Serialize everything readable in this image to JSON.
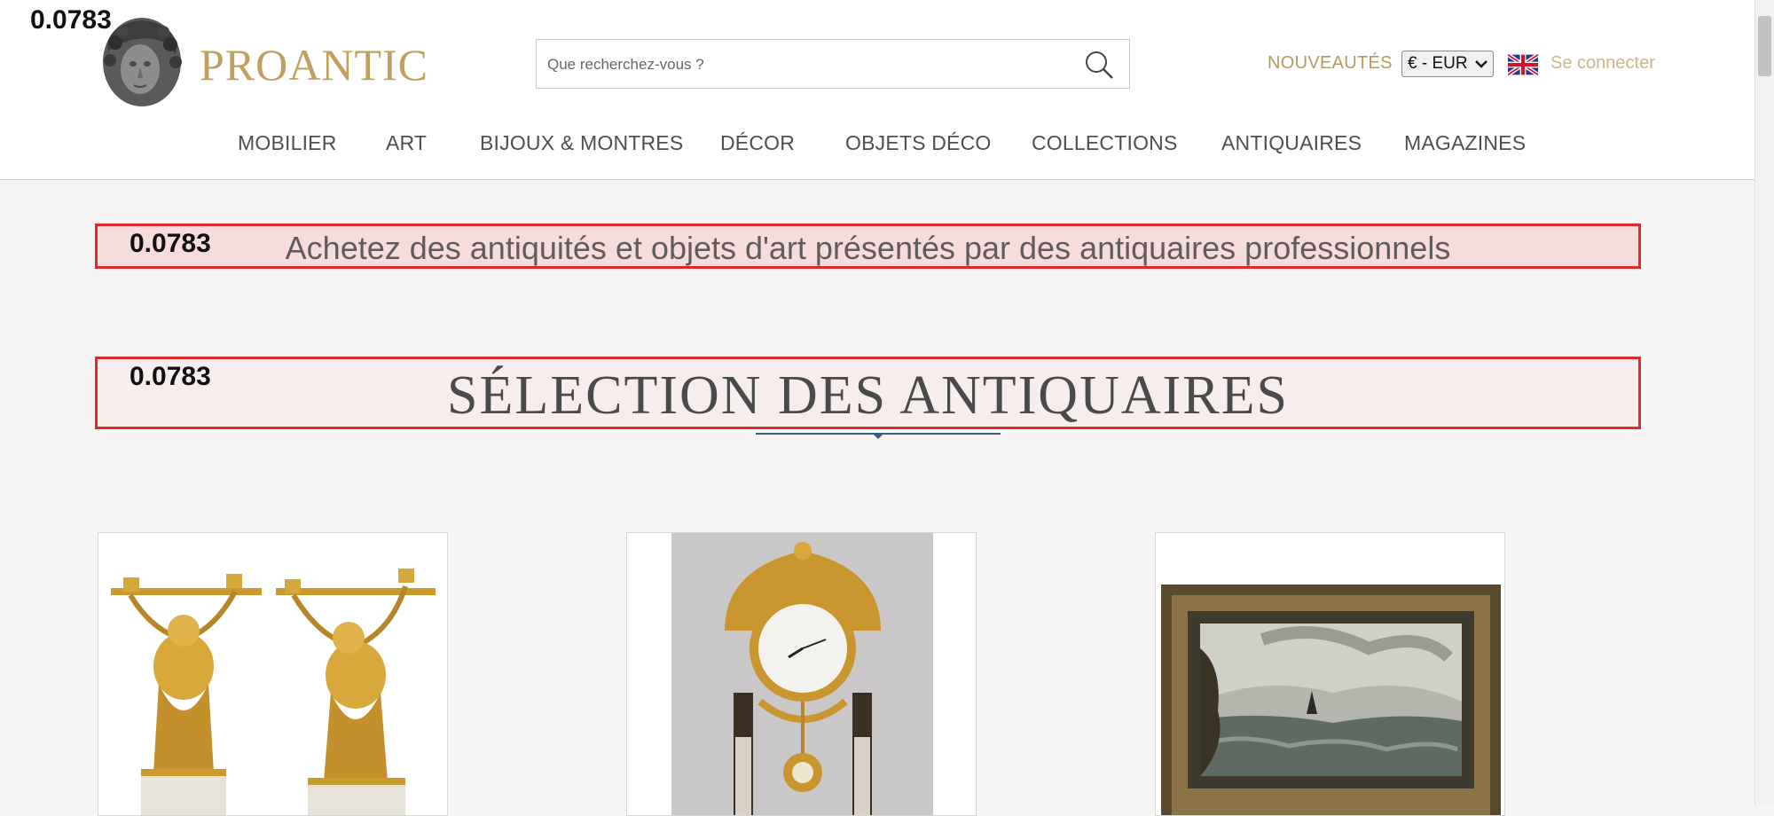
{
  "scores": {
    "top": "0.0783",
    "banner1": "0.0783",
    "banner2": "0.0783"
  },
  "header": {
    "logo": "PROANTIC",
    "search": {
      "placeholder": "Que recherchez-vous ?"
    },
    "nouveautes": "NOUVEAUTÉS",
    "currency": "€ - EUR",
    "connect": "Se connecter"
  },
  "nav": [
    "MOBILIER",
    "ART",
    "BIJOUX & MONTRES",
    "DÉCOR",
    "OBJETS DÉCO",
    "COLLECTIONS",
    "ANTIQUAIRES",
    "MAGAZINES"
  ],
  "banners": {
    "subtitle": "Achetez des antiquités et objets d'art présentés par des antiquaires professionnels",
    "section_title": "SÉLECTION DES ANTIQUAIRES"
  },
  "colors": {
    "gold": "#c0a05e",
    "accent_red": "#e02a2a",
    "navy": "#3d5a78"
  },
  "icons": {
    "search": "search-icon",
    "flag": "uk-flag-icon",
    "dropdown": "chevron-down-icon"
  },
  "products": [
    {
      "name": "gilt-bronze-cherub-candelabra"
    },
    {
      "name": "gilt-bronze-portico-clock"
    },
    {
      "name": "seascape-oil-painting"
    }
  ]
}
